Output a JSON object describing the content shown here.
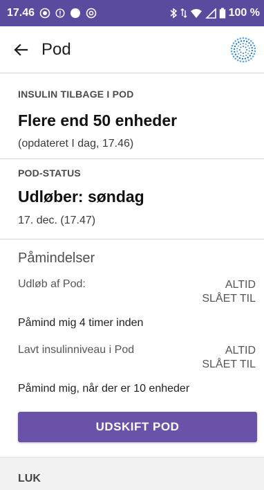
{
  "status_bar": {
    "time": "17.46",
    "battery": "100 %",
    "icons": [
      "record-icon",
      "circle-info-icon",
      "dot-icon",
      "at-icon",
      "bluetooth-icon",
      "data-transfer-icon",
      "wifi-icon",
      "signal-icon",
      "battery-icon"
    ],
    "background": "#5b4b9e"
  },
  "app_bar": {
    "title": "Pod",
    "back_icon": "arrow-left-icon",
    "logo_icon": "pod-logo-icon"
  },
  "insulin": {
    "label": "INSULIN TILBAGE I POD",
    "value": "Flere end 50 enheder",
    "updated": "(opdateret I dag, 17.46)"
  },
  "pod_status": {
    "label": "POD-STATUS",
    "value": "Udløber: søndag",
    "date": "17. dec. (17.47)"
  },
  "reminders": {
    "title": "Påmindelser",
    "items": [
      {
        "label": "Udløb af Pod:",
        "value_line1": "ALTID",
        "value_line2": "SLÅET TIL",
        "description": "Påmind mig 4 timer inden"
      },
      {
        "label": "Lavt insulinniveau i Pod",
        "value_line1": "ALTID",
        "value_line2": "SLÅET TIL",
        "description": "Påmind mig, når der er 10 enheder"
      }
    ]
  },
  "replace_button": {
    "label": "UDSKIFT POD",
    "color": "#6b52a9"
  },
  "footer": {
    "close_label": "LUK"
  }
}
